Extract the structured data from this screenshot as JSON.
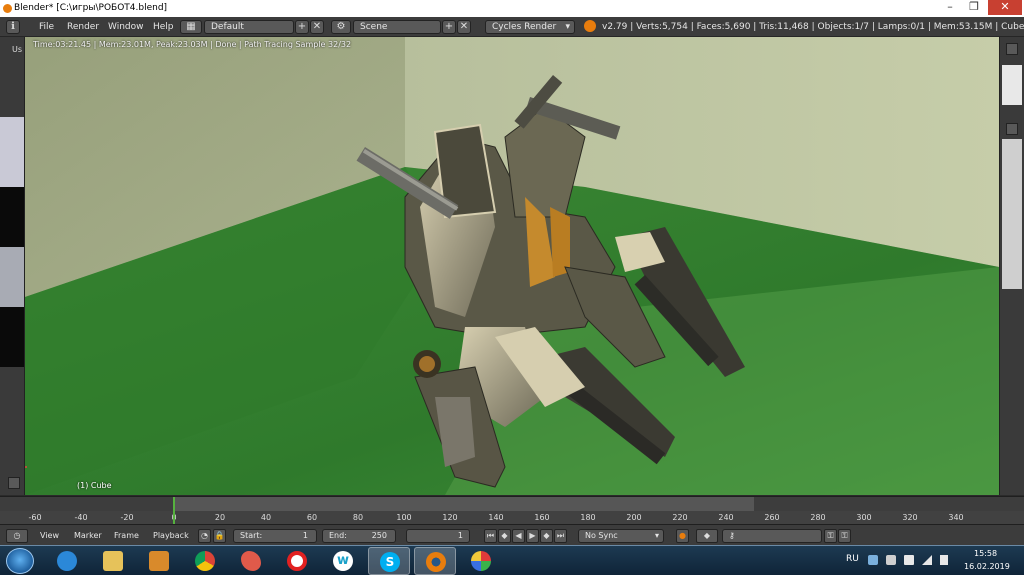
{
  "window": {
    "title": "Blender* [C:\\игры\\РОБОТ4.blend]"
  },
  "info_header": {
    "menus": [
      "File",
      "Render",
      "Window",
      "Help"
    ],
    "screen_layout": "Default",
    "scene": "Scene",
    "render_engine": "Cycles Render",
    "stats": "v2.79 | Verts:5,754 | Faces:5,690 | Tris:11,468 | Objects:1/7 | Lamps:0/1 | Mem:53.15M | Cube"
  },
  "viewport": {
    "render_status": "Time:03:21.45 | Mem:23.01M, Peak:23.03M | Done | Path Tracing Sample 32/32",
    "object_label": "(1) Cube",
    "left_strip_label": "Us"
  },
  "timeline": {
    "ticks": [
      "-60",
      "-40",
      "-20",
      "0",
      "20",
      "40",
      "60",
      "80",
      "100",
      "120",
      "140",
      "160",
      "180",
      "200",
      "220",
      "240",
      "260",
      "280",
      "300",
      "320",
      "340"
    ],
    "current_frame_value": 1,
    "menus": [
      "View",
      "Marker",
      "Frame",
      "Playback"
    ],
    "start_label": "Start:",
    "start_value": "1",
    "end_label": "End:",
    "end_value": "250",
    "current_frame": "1",
    "sync": "No Sync"
  },
  "taskbar": {
    "apps": [
      "internet-explorer",
      "file-explorer",
      "media-player",
      "paint",
      "chrome",
      "opera",
      "app-w",
      "skype",
      "blender",
      "paint-2"
    ],
    "language": "RU",
    "time": "15:58",
    "date": "16.02.2019"
  },
  "colors": {
    "accent_orange": "#e87d0d",
    "playhead_green": "#56b13f",
    "floor_green": "#3f8a3a",
    "wall": "#a8b08c"
  }
}
